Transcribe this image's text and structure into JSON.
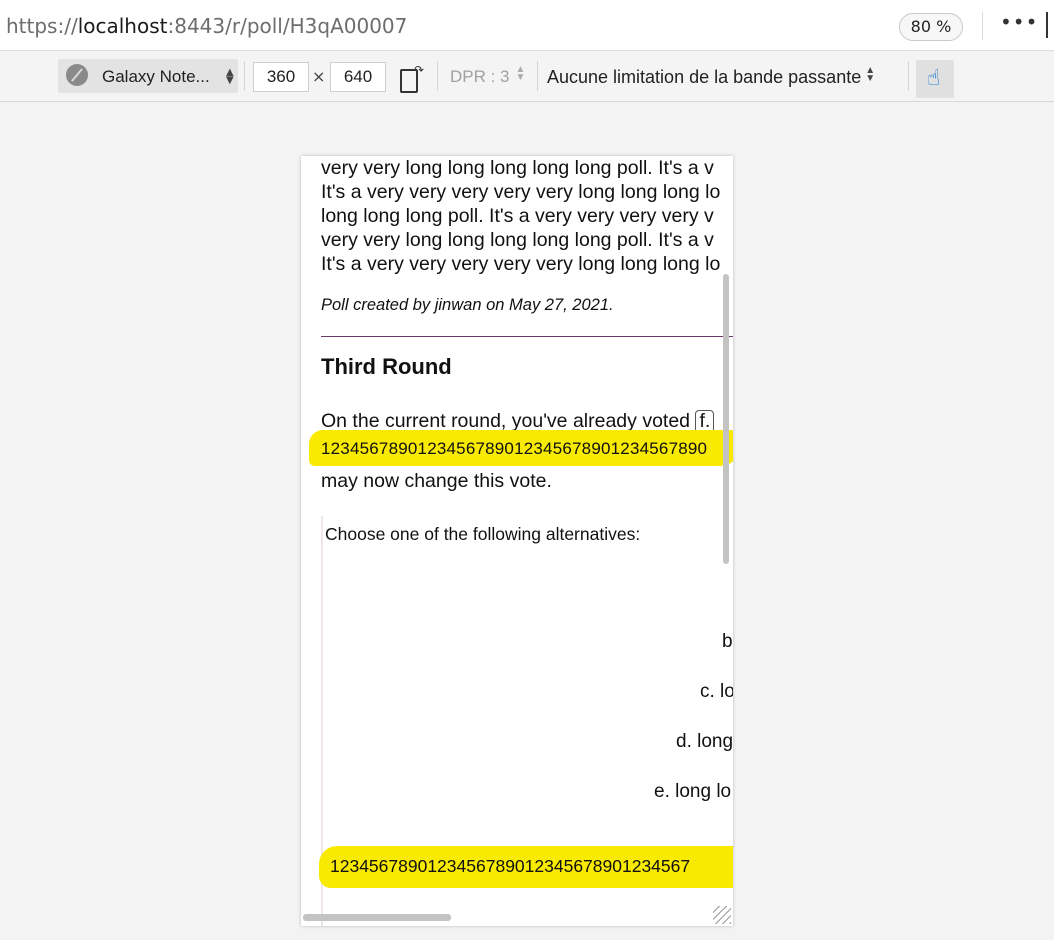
{
  "address_bar": {
    "scheme": "https://",
    "host": "localhost",
    "rest": ":8443/r/poll/H3qA00007",
    "zoom": "80 %",
    "more_icon": "ellipsis-icon"
  },
  "rdm_toolbar": {
    "device_name": "Galaxy Note...",
    "width": "360",
    "times": "×",
    "height": "640",
    "dpr": "DPR : 3",
    "throttling": "Aucune limitation de la bande passante",
    "rotate_icon": "rotate-device-icon",
    "touch_icon": "touch-simulation-icon",
    "accent_color": "#0a6ed1"
  },
  "page": {
    "description_lines": [
      "very very long long long long long poll. It's a v",
      "It's a very very very very very long long long lo",
      "long long long poll. It's a very very very very v",
      "very very long long long long long poll. It's a v",
      "It's a very very very very very long long long lo"
    ],
    "credit": "Poll created by jinwan on May 27, 2021.",
    "round_title": "Third Round",
    "voted_prefix": "On the current round, you've already voted",
    "voted_choice": "f.",
    "voted_choice_long": "1234567890123456789012345678901234567890",
    "change_text": "may now change this vote.",
    "alternatives_prompt": "Choose one of the following alternatives:",
    "alternatives": [
      "b",
      "c. lo",
      "d. long",
      "e. long lo"
    ],
    "last_alternative": "1234567890123456789012345678901234567",
    "highlight_color": "#f8ea00"
  }
}
